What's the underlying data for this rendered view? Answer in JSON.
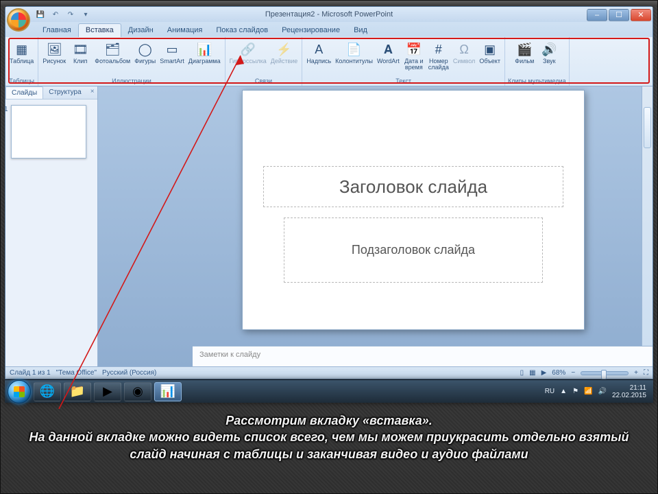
{
  "titlebar": {
    "title": "Презентация2 - Microsoft PowerPoint"
  },
  "win_controls": {
    "min": "–",
    "max": "☐",
    "close": "✕"
  },
  "tabs": {
    "items": [
      "Главная",
      "Вставка",
      "Дизайн",
      "Анимация",
      "Показ слайдов",
      "Рецензирование",
      "Вид"
    ],
    "active_index": 1
  },
  "ribbon": {
    "groups": [
      {
        "label": "Таблицы",
        "buttons": [
          {
            "name": "table",
            "icon": "▦",
            "label": "Таблица"
          }
        ]
      },
      {
        "label": "Иллюстрации",
        "buttons": [
          {
            "name": "picture",
            "icon": "🖼",
            "label": "Рисунок"
          },
          {
            "name": "clip",
            "icon": "🎞",
            "label": "Клип"
          },
          {
            "name": "album",
            "icon": "🗂",
            "label": "Фотоальбом"
          },
          {
            "name": "shapes",
            "icon": "◯",
            "label": "Фигуры"
          },
          {
            "name": "smartart",
            "icon": "▭",
            "label": "SmartArt"
          },
          {
            "name": "chart",
            "icon": "📊",
            "label": "Диаграмма"
          }
        ]
      },
      {
        "label": "Связи",
        "buttons": [
          {
            "name": "hyperlink",
            "icon": "🔗",
            "label": "Гиперссылка",
            "disabled": true
          },
          {
            "name": "action",
            "icon": "⚡",
            "label": "Действие",
            "disabled": true
          }
        ]
      },
      {
        "label": "Текст",
        "buttons": [
          {
            "name": "textbox",
            "icon": "A",
            "label": "Надпись"
          },
          {
            "name": "hf",
            "icon": "📄",
            "label": "Колонтитулы"
          },
          {
            "name": "wordart",
            "icon": "𝐀",
            "label": "WordArt"
          },
          {
            "name": "datetime",
            "icon": "📅",
            "label": "Дата и\nвремя"
          },
          {
            "name": "slidenum",
            "icon": "#",
            "label": "Номер\nслайда"
          },
          {
            "name": "symbol",
            "icon": "Ω",
            "label": "Символ",
            "disabled": true
          },
          {
            "name": "object",
            "icon": "▣",
            "label": "Объект"
          }
        ]
      },
      {
        "label": "Клипы мультимедиа",
        "buttons": [
          {
            "name": "movie",
            "icon": "🎬",
            "label": "Фильм"
          },
          {
            "name": "sound",
            "icon": "🔊",
            "label": "Звук"
          }
        ]
      }
    ]
  },
  "left_pane": {
    "tab_slides": "Слайды",
    "tab_outline": "Структура",
    "close": "×"
  },
  "slide": {
    "title_placeholder": "Заголовок слайда",
    "sub_placeholder": "Подзаголовок слайда"
  },
  "notes": {
    "placeholder": "Заметки к слайду"
  },
  "statusbar": {
    "slide_info": "Слайд 1 из 1",
    "theme": "\"Тема Office\"",
    "lang": "Русский (Россия)",
    "zoom": "68%"
  },
  "taskbar": {
    "lang": "RU",
    "time": "21:11",
    "date": "22.02.2015"
  },
  "caption": {
    "line1": "Рассмотрим вкладку «вставка».",
    "line2": "На данной вкладке можно видеть список всего, чем мы можем приукрасить отдельно взятый слайд начиная с таблицы и заканчивая видео и аудио файлами"
  }
}
